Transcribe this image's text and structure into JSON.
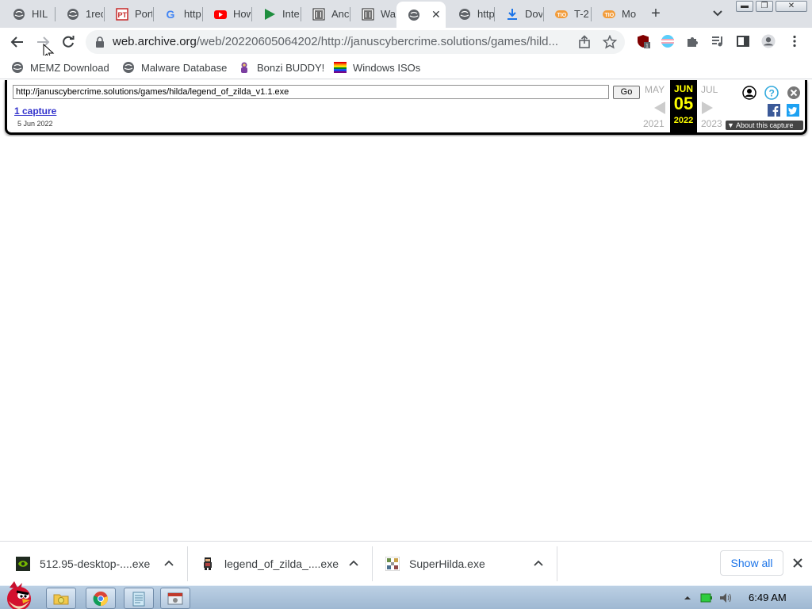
{
  "tabs": [
    {
      "title": "HIL",
      "icon": "globe-icon"
    },
    {
      "title": "1rec",
      "icon": "globe-icon"
    },
    {
      "title": "Port",
      "icon": "pt-logo-icon"
    },
    {
      "title": "http",
      "icon": "google-icon"
    },
    {
      "title": "How",
      "icon": "youtube-icon"
    },
    {
      "title": "Inte",
      "icon": "play-icon"
    },
    {
      "title": "Anc",
      "icon": "archive-icon"
    },
    {
      "title": "Wa",
      "icon": "archive-icon"
    },
    {
      "title": "",
      "icon": "globe-icon",
      "active": true
    },
    {
      "title": "http",
      "icon": "globe-icon"
    },
    {
      "title": "Dov",
      "icon": "download-icon"
    },
    {
      "title": "T-2",
      "icon": "tio-icon"
    },
    {
      "title": "Mo",
      "icon": "tio-icon"
    }
  ],
  "toolbar": {
    "url_domain": "web.archive.org",
    "url_path": "/web/20220605064202/http://januscybercrime.solutions/games/hild..."
  },
  "bookmarks": [
    {
      "label": "MEMZ Download",
      "icon": "globe-icon"
    },
    {
      "label": "Malware Database",
      "icon": "globe-icon"
    },
    {
      "label": "Bonzi BUDDY!",
      "icon": "bonzi-icon"
    },
    {
      "label": "Windows ISOs",
      "icon": "rainbow-flag-icon"
    }
  ],
  "wayback": {
    "url_value": "http://januscybercrime.solutions/games/hilda/legend_of_zilda_v1.1.exe",
    "go_label": "Go",
    "captures_label": "1 capture",
    "capture_date": "5 Jun 2022",
    "prev_month": "MAY",
    "cur_month": "JUN",
    "next_month": "JUL",
    "prev_year": "2021",
    "cur_day": "05",
    "cur_year": "2022",
    "next_year": "2023",
    "about_label": "About this capture"
  },
  "downloads": [
    {
      "name": "512.95-desktop-....exe",
      "icon": "nvidia-icon"
    },
    {
      "name": "legend_of_zilda_....exe",
      "icon": "zilda-icon"
    },
    {
      "name": "SuperHilda.exe",
      "icon": "superhilda-icon"
    }
  ],
  "download_shelf": {
    "show_all": "Show all"
  },
  "taskbar": {
    "time": "6:49 AM"
  }
}
